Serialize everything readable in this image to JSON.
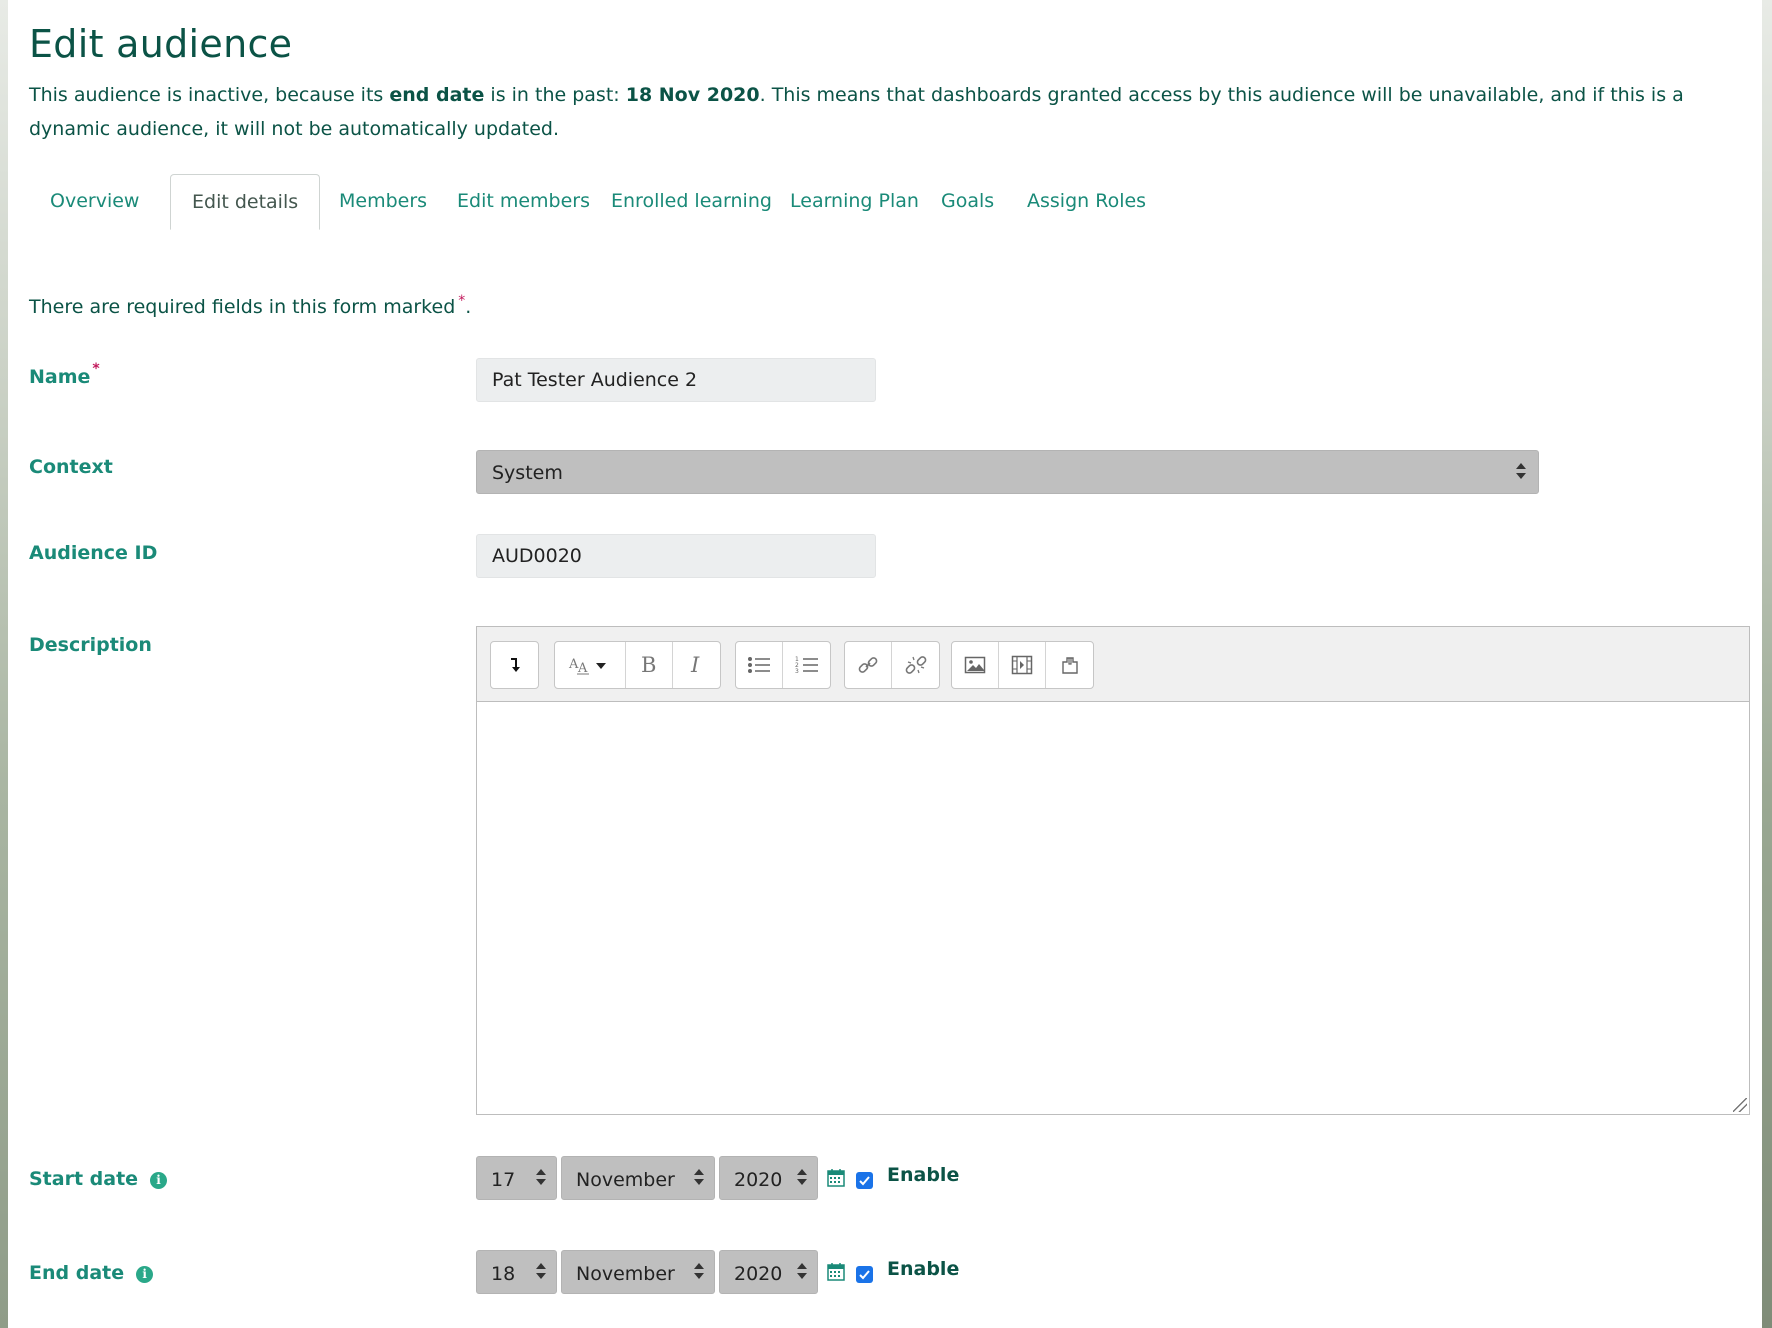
{
  "page": {
    "title": "Edit audience",
    "notice": {
      "part1": "This audience is inactive, because its ",
      "bold1": "end date",
      "part2": " is in the past: ",
      "bold2": "18 Nov 2020",
      "part3": ". This means that dashboards granted access by this audience will be unavailable, and if this is a dynamic audience, it will not be automatically updated."
    }
  },
  "tabs": [
    {
      "label": "Overview",
      "active": false
    },
    {
      "label": "Edit details",
      "active": true
    },
    {
      "label": "Members",
      "active": false
    },
    {
      "label": "Edit members",
      "active": false
    },
    {
      "label": "Enrolled learning",
      "active": false
    },
    {
      "label": "Learning Plan",
      "active": false
    },
    {
      "label": "Goals",
      "active": false
    },
    {
      "label": "Assign Roles",
      "active": false
    }
  ],
  "form": {
    "required_note": "There are required fields in this form marked",
    "required_note_end": ".",
    "required_star": "*",
    "name": {
      "label": "Name",
      "value": "Pat Tester Audience 2"
    },
    "context": {
      "label": "Context",
      "value": "System"
    },
    "audience_id": {
      "label": "Audience ID",
      "value": "AUD0020"
    },
    "description": {
      "label": "Description",
      "value": ""
    },
    "start_date": {
      "label": "Start date",
      "day": "17",
      "month": "November",
      "year": "2020",
      "enabled": true,
      "enable_label": "Enable"
    },
    "end_date": {
      "label": "End date",
      "day": "18",
      "month": "November",
      "year": "2020",
      "enabled": true,
      "enable_label": "Enable"
    }
  },
  "editor_toolbar": [
    [
      "expand-toolbar-icon"
    ],
    [
      "font-style-icon",
      "bold-icon",
      "italic-icon"
    ],
    [
      "unordered-list-icon",
      "ordered-list-icon"
    ],
    [
      "link-icon",
      "unlink-icon"
    ],
    [
      "image-icon",
      "media-icon",
      "manage-files-icon"
    ]
  ],
  "colors": {
    "heading": "#0b5346",
    "link": "#1a8a78",
    "required": "#c2185b",
    "checkbox": "#1a73e8"
  }
}
